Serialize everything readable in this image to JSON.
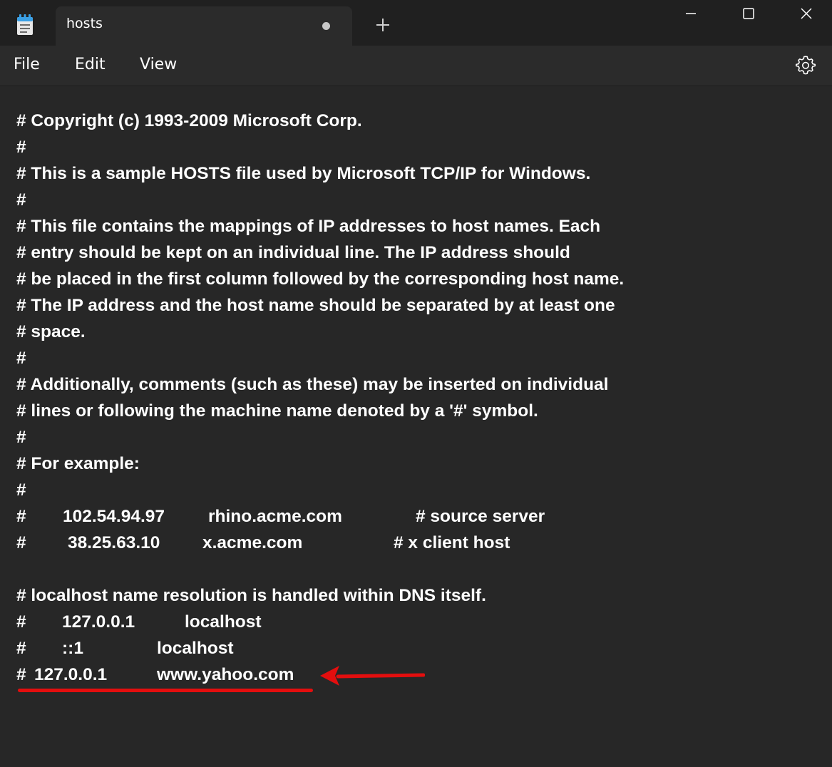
{
  "window": {
    "tab_title": "hosts",
    "icons": {
      "app": "notepad-icon",
      "unsaved": "unsaved-dot-icon",
      "new_tab": "plus-icon",
      "minimize": "minimize-icon",
      "maximize": "maximize-icon",
      "close": "close-icon",
      "settings": "gear-icon"
    }
  },
  "menu": {
    "file": "File",
    "edit": "Edit",
    "view": "View"
  },
  "editor": {
    "lines": {
      "l1": "# Copyright (c) 1993-2009 Microsoft Corp.",
      "l2": "#",
      "l3": "# This is a sample HOSTS file used by Microsoft TCP/IP for Windows.",
      "l4": "#",
      "l5": "# This file contains the mappings of IP addresses to host names. Each",
      "l6": "# entry should be kept on an individual line. The IP address should",
      "l7": "# be placed in the first column followed by the corresponding host name.",
      "l8": "# The IP address and the host name should be separated by at least one",
      "l9": "# space.",
      "l10": "#",
      "l11": "# Additionally, comments (such as these) may be inserted on individual",
      "l12": "# lines or following the machine name denoted by a '#' symbol.",
      "l13": "#",
      "l14": "# For example:",
      "l15": "#",
      "l19": "# localhost name resolution is handled within DNS itself."
    },
    "example1": {
      "hash": "#",
      "ip": "102.54.94.97",
      "host": "rhino.acme.com",
      "comment": "# source server"
    },
    "example2": {
      "hash": "#",
      "ip": "38.25.63.10",
      "host": "x.acme.com",
      "comment": "# x client host"
    },
    "localhost1": {
      "hash": "#",
      "ip": "127.0.0.1",
      "host": "localhost"
    },
    "localhost2": {
      "hash": "#",
      "ip": "::1",
      "host": "localhost"
    },
    "custom_entry": {
      "hash": "#",
      "ip": "127.0.0.1",
      "host": "www.yahoo.com"
    }
  },
  "annotation": {
    "color": "#e30e0e"
  },
  "colors": {
    "titlebar": "#202020",
    "tab": "#2b2b2b",
    "editor_bg": "#272727",
    "text": "#ffffff"
  }
}
